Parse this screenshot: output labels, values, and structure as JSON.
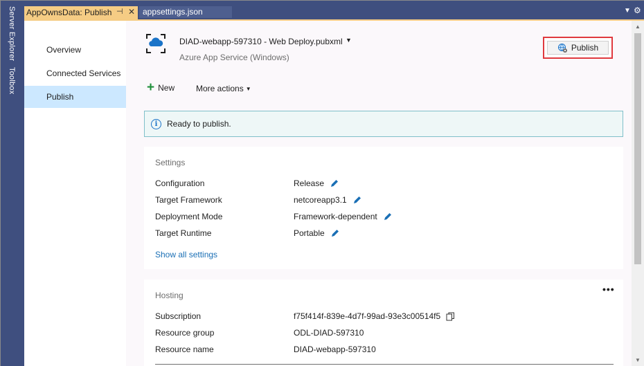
{
  "side_tool_windows": [
    "Server Explorer",
    "Toolbox"
  ],
  "tabs": [
    {
      "label": "AppOwnsData: Publish",
      "pin": "⊣",
      "close": "✕",
      "active": true
    },
    {
      "label": "appsettings.json",
      "active": false
    }
  ],
  "tabstrip_icons": {
    "dropdown": "▼",
    "settings": "⚙"
  },
  "nav": {
    "items": [
      {
        "label": "Overview",
        "selected": false
      },
      {
        "label": "Connected Services",
        "selected": false
      },
      {
        "label": "Publish",
        "selected": true
      }
    ]
  },
  "profile": {
    "name": "DIAD-webapp-597310 - Web Deploy.pubxml",
    "caret": "▼",
    "subtitle": "Azure App Service (Windows)",
    "icon": "cloud-service-icon"
  },
  "publish_button": {
    "label": "Publish",
    "icon": "globe-gear-icon",
    "highlight_color": "#e0393e"
  },
  "toolbar": {
    "new_label": "New",
    "new_icon": "+",
    "more_label": "More actions",
    "more_caret": "▼"
  },
  "banner": {
    "icon": "i",
    "text": "Ready to publish."
  },
  "settings": {
    "title": "Settings",
    "rows": [
      {
        "label": "Configuration",
        "value": "Release"
      },
      {
        "label": "Target Framework",
        "value": "netcoreapp3.1"
      },
      {
        "label": "Deployment Mode",
        "value": "Framework-dependent"
      },
      {
        "label": "Target Runtime",
        "value": "Portable"
      }
    ],
    "show_all_link": "Show all settings"
  },
  "hosting": {
    "title": "Hosting",
    "more_icon": "•••",
    "rows": [
      {
        "label": "Subscription",
        "value": "f75f414f-839e-4d7f-99ad-93e3c00514f5"
      },
      {
        "label": "Resource group",
        "value": "ODL-DIAD-597310"
      },
      {
        "label": "Resource name",
        "value": "DIAD-webapp-597310"
      }
    ]
  },
  "scrollbar": {
    "up": "▲",
    "down": "▼"
  },
  "colors": {
    "active_tab": "#f5cc84",
    "chrome": "#3f4f7f",
    "selected_nav": "#cce8ff",
    "link": "#1a6fb5",
    "banner_border": "#7fbfc9",
    "accent_blue": "#1a73c8"
  }
}
